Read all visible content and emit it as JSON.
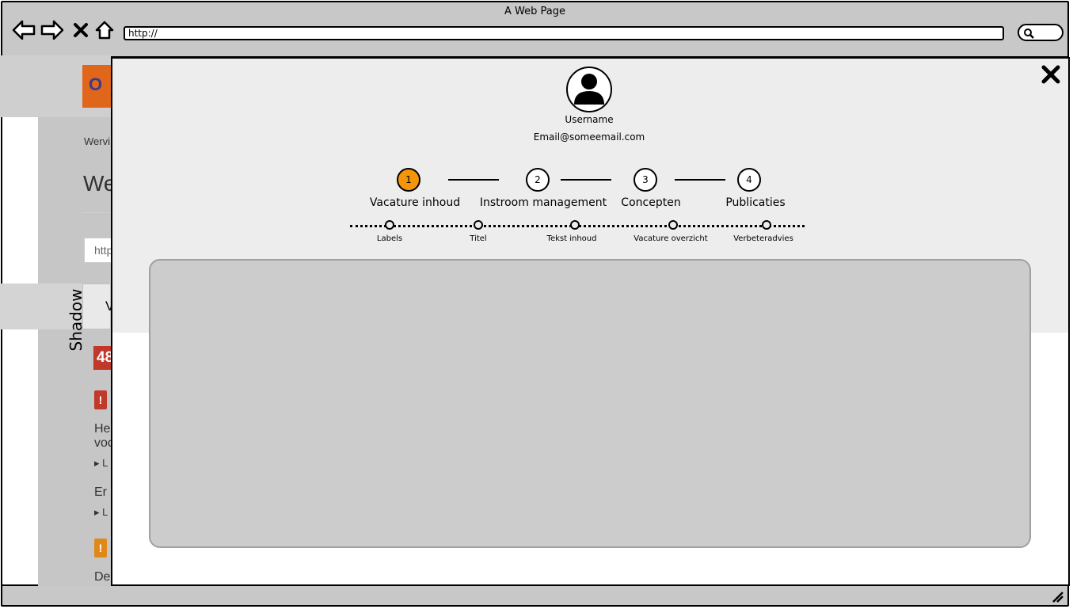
{
  "browser": {
    "window_title": "A Web Page",
    "url": "http://"
  },
  "background_page": {
    "logo_text": "O",
    "breadcrumb": "Wervi",
    "heading": "We",
    "input_text": "http",
    "tab_text": "V",
    "shadow_label": "Shadow",
    "badge_number": "48",
    "alert_icon": "!",
    "paragraph1_line1": "He",
    "paragraph1_line2": "voo",
    "list_item1": "L",
    "paragraph2": "Er",
    "list_item2": "L",
    "paragraph3": "De",
    "colors": {
      "red": "#c0392b",
      "orange": "#e0891b",
      "logo": "#e0661b"
    }
  },
  "modal": {
    "user": {
      "username": "Username",
      "email": "Email@someemail.com"
    },
    "steps": [
      {
        "number": "1",
        "label": "Vacature inhoud",
        "active": true
      },
      {
        "number": "2",
        "label": "Instroom management",
        "active": false
      },
      {
        "number": "3",
        "label": "Concepten",
        "active": false
      },
      {
        "number": "4",
        "label": "Publicaties",
        "active": false
      }
    ],
    "substeps": [
      {
        "label": "Labels"
      },
      {
        "label": "Titel"
      },
      {
        "label": "Tekst inhoud"
      },
      {
        "label": "Vacature overzicht"
      },
      {
        "label": "Verbeteradvies"
      }
    ],
    "colors": {
      "active_step": "#f5950a",
      "panel": "#cccccc",
      "header_bg": "#ededed"
    }
  }
}
